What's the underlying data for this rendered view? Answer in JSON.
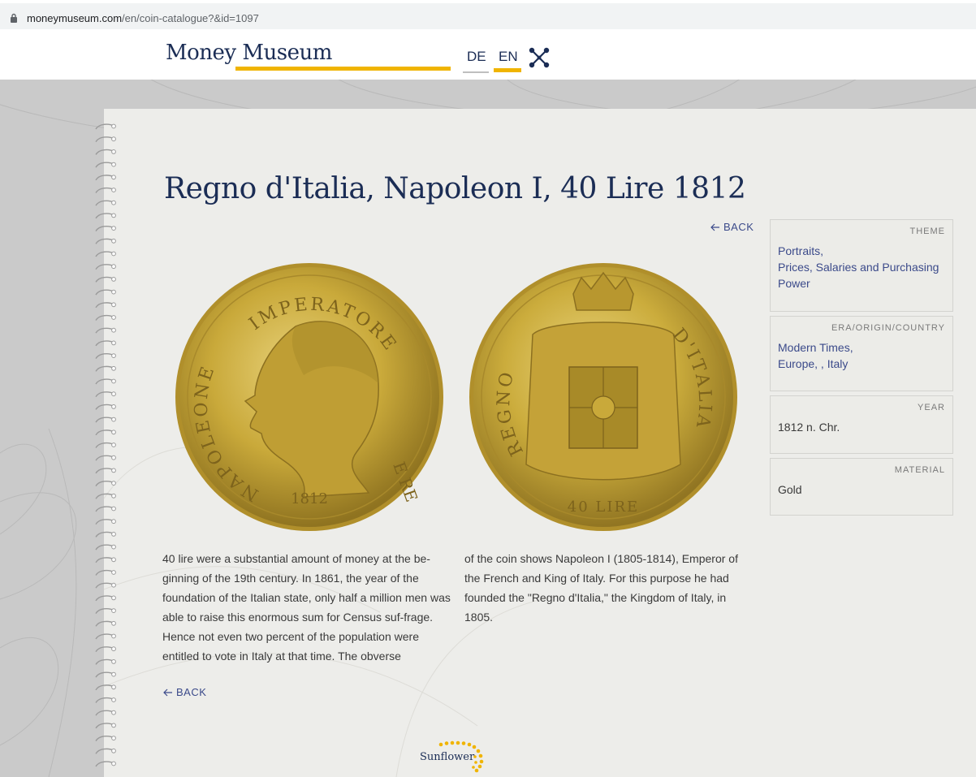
{
  "browser": {
    "url_domain": "moneymuseum.com",
    "url_path": "/en/coin-catalogue?&id=1097"
  },
  "header": {
    "logo": "Money Museum",
    "lang_de": "DE",
    "lang_en": "EN",
    "active_lang": "EN"
  },
  "page": {
    "title": "Regno d'Italia, Napoleon I, 40 Lire 1812",
    "back_label": "BACK",
    "description_left": "40 lire were a substantial amount of money at the be-ginning of the 19th century. In 1861, the year of the foundation of the Italian state, only half a million men was able to raise this enormous sum for Census suf-frage. Hence not even two percent of the population were entitled to vote in Italy at that time. The obverse",
    "description_right": "of the coin shows Napoleon I (1805-1814), Emperor of the French and King of Italy. For this purpose he had founded the \"Regno d'Italia,\" the Kingdom of Italy, in 1805."
  },
  "coins": {
    "obverse_legend_top": "IMPERATORE",
    "obverse_legend_left": "NAPOLEONE",
    "obverse_legend_right": "E RE",
    "obverse_year": "1812",
    "reverse_legend_left": "REGNO",
    "reverse_legend_right": "D'ITALIA",
    "reverse_value": "40 LIRE"
  },
  "info": {
    "theme_label": "THEME",
    "theme_values": [
      "Portraits,",
      "Prices, Salaries and Purchasing Power"
    ],
    "era_label": "ERA/ORIGIN/COUNTRY",
    "era_values": [
      "Modern Times,",
      "Europe, , Italy"
    ],
    "year_label": "YEAR",
    "year_value": "1812 n. Chr.",
    "material_label": "MATERIAL",
    "material_value": "Gold"
  },
  "footer": {
    "sponsor": "Sunflower"
  },
  "colors": {
    "brand_navy": "#1b2d55",
    "accent_yellow": "#f0b400",
    "link_blue": "#3b4a8a",
    "paper": "#ededea",
    "gold": "#c9a93a"
  }
}
